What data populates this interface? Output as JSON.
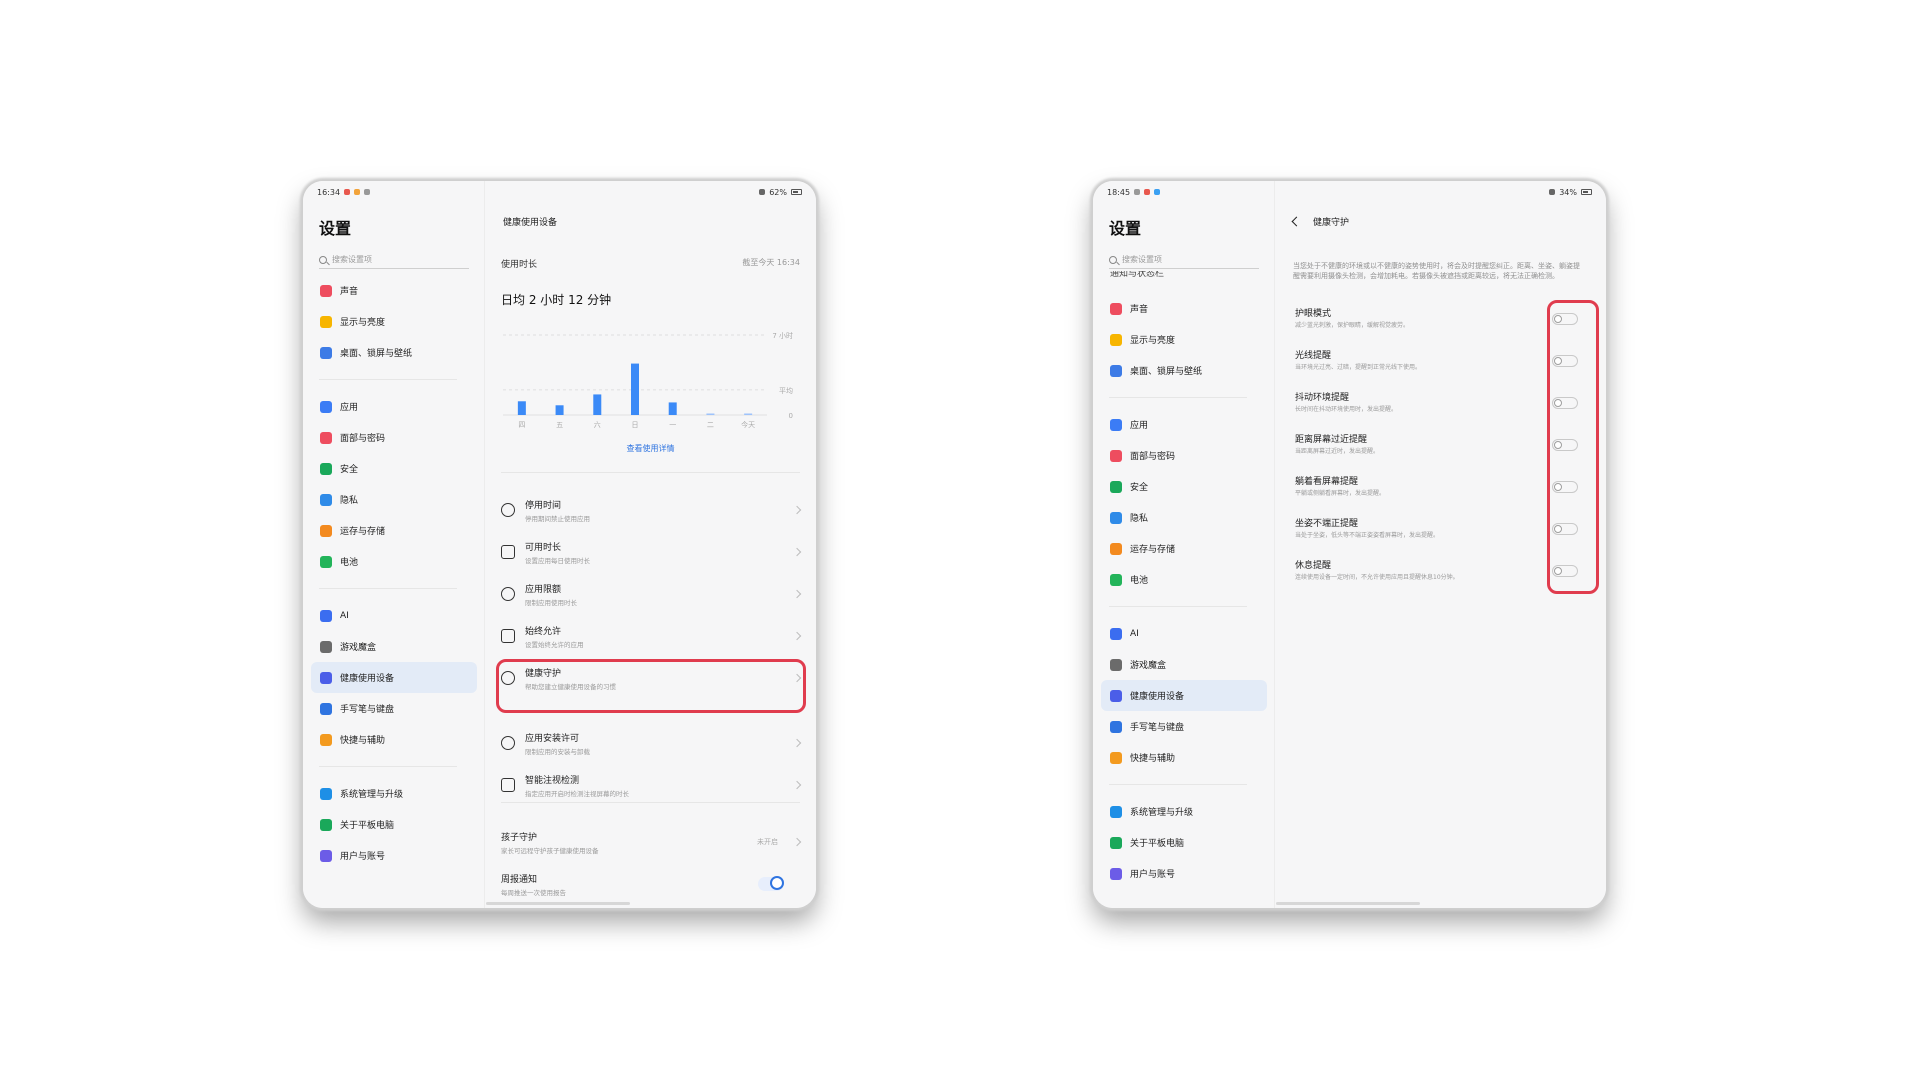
{
  "left": {
    "status": {
      "time": "16:34",
      "battery": "62%"
    },
    "sidebar": {
      "title": "设置",
      "search_placeholder": "搜索设置项",
      "groups": [
        [
          {
            "label": "声音",
            "icon": "speaker-icon",
            "color": "#ee4d5f"
          },
          {
            "label": "显示与亮度",
            "icon": "sun-icon",
            "color": "#f7b500"
          },
          {
            "label": "桌面、锁屏与壁纸",
            "icon": "wallpaper-icon",
            "color": "#3d7be6"
          }
        ],
        [
          {
            "label": "应用",
            "icon": "apps-icon",
            "color": "#3b7cf5"
          },
          {
            "label": "面部与密码",
            "icon": "face-icon",
            "color": "#ee4d5f"
          },
          {
            "label": "安全",
            "icon": "shield-icon",
            "color": "#1aa85a"
          },
          {
            "label": "隐私",
            "icon": "privacy-icon",
            "color": "#2f8be8"
          },
          {
            "label": "运存与存储",
            "icon": "storage-icon",
            "color": "#f38a1f"
          },
          {
            "label": "电池",
            "icon": "battery-icon",
            "color": "#23b45a"
          }
        ],
        [
          {
            "label": "AI",
            "icon": "ai-icon",
            "color": "#3b6df0"
          },
          {
            "label": "游戏魔盒",
            "icon": "gamepad-icon",
            "color": "#6b6b6b"
          },
          {
            "label": "健康使用设备",
            "icon": "hourglass-icon",
            "color": "#4b5ee8",
            "active": true
          },
          {
            "label": "手写笔与键盘",
            "icon": "pen-icon",
            "color": "#2f74e0"
          },
          {
            "label": "快捷与辅助",
            "icon": "shortcut-icon",
            "color": "#f39a1f"
          }
        ],
        [
          {
            "label": "系统管理与升级",
            "icon": "system-icon",
            "color": "#1e8fe6"
          },
          {
            "label": "关于平板电脑",
            "icon": "info-icon",
            "color": "#1aa85a"
          },
          {
            "label": "用户与账号",
            "icon": "user-icon",
            "color": "#6c5ce7"
          }
        ]
      ]
    },
    "content": {
      "title": "健康使用设备",
      "usage_label": "使用时长",
      "usage_time": "截至今天 16:34",
      "usage_avg": "日均 2 小时 12 分钟",
      "chart_link": "查看使用详情",
      "rows_a": [
        {
          "title": "停用时间",
          "sub": "停用期间禁止使用应用",
          "icon": "downtime-icon"
        },
        {
          "title": "可用时长",
          "sub": "设置应用每日使用时长",
          "icon": "timer-icon"
        },
        {
          "title": "应用限额",
          "sub": "限制应用使用时长",
          "icon": "app-limit-icon"
        },
        {
          "title": "始终允许",
          "sub": "设置始终允许的应用",
          "icon": "always-allow-icon"
        },
        {
          "title": "健康守护",
          "sub": "帮助您建立健康使用设备的习惯",
          "icon": "sprout-icon"
        }
      ],
      "rows_b": [
        {
          "title": "应用安装许可",
          "sub": "限制应用的安装与卸载",
          "icon": "install-icon"
        },
        {
          "title": "智能注视检测",
          "sub": "指定应用开启时检测注视屏幕的时长",
          "icon": "gaze-icon"
        }
      ],
      "child": {
        "title": "孩子守护",
        "sub": "家长可远程守护孩子健康使用设备",
        "status": "未开启"
      },
      "weekly": {
        "title": "周报通知",
        "sub": "每周推送一次使用报告"
      }
    },
    "chart_data": {
      "type": "bar",
      "categories": [
        "四",
        "五",
        "六",
        "日",
        "一",
        "二",
        "今天"
      ],
      "values": [
        1.2,
        0.85,
        1.8,
        4.5,
        1.1,
        0,
        0.05
      ],
      "y_tick_labels": [
        "7 小时",
        "平均",
        "0"
      ],
      "ylim": [
        0,
        7
      ],
      "average": 2.2,
      "bar_color": "#3b8af7",
      "grid": true
    }
  },
  "right": {
    "status": {
      "time": "18:45",
      "battery": "34%"
    },
    "sidebar": {
      "title": "设置",
      "search_placeholder": "搜索设置项",
      "clipped_item": "通知与状态栏",
      "groups": [
        [
          {
            "label": "声音",
            "icon": "speaker-icon",
            "color": "#ee4d5f"
          },
          {
            "label": "显示与亮度",
            "icon": "sun-icon",
            "color": "#f7b500"
          },
          {
            "label": "桌面、锁屏与壁纸",
            "icon": "wallpaper-icon",
            "color": "#3d7be6"
          }
        ],
        [
          {
            "label": "应用",
            "icon": "apps-icon",
            "color": "#3b7cf5"
          },
          {
            "label": "面部与密码",
            "icon": "face-icon",
            "color": "#ee4d5f"
          },
          {
            "label": "安全",
            "icon": "shield-icon",
            "color": "#1aa85a"
          },
          {
            "label": "隐私",
            "icon": "privacy-icon",
            "color": "#2f8be8"
          },
          {
            "label": "运存与存储",
            "icon": "storage-icon",
            "color": "#f38a1f"
          },
          {
            "label": "电池",
            "icon": "battery-icon",
            "color": "#23b45a"
          }
        ],
        [
          {
            "label": "AI",
            "icon": "ai-icon",
            "color": "#3b6df0"
          },
          {
            "label": "游戏魔盒",
            "icon": "gamepad-icon",
            "color": "#6b6b6b"
          },
          {
            "label": "健康使用设备",
            "icon": "hourglass-icon",
            "color": "#4b5ee8",
            "active": true
          },
          {
            "label": "手写笔与键盘",
            "icon": "pen-icon",
            "color": "#2f74e0"
          },
          {
            "label": "快捷与辅助",
            "icon": "shortcut-icon",
            "color": "#f39a1f"
          }
        ],
        [
          {
            "label": "系统管理与升级",
            "icon": "system-icon",
            "color": "#1e8fe6"
          },
          {
            "label": "关于平板电脑",
            "icon": "info-icon",
            "color": "#1aa85a"
          },
          {
            "label": "用户与账号",
            "icon": "user-icon",
            "color": "#6c5ce7"
          }
        ]
      ]
    },
    "content": {
      "title": "健康守护",
      "desc": "当您处于不健康的环境或以不健康的姿势使用时，将会及时提醒您纠正。距离、坐姿、躺姿提醒需要利用摄像头检测，会增加耗电。若摄像头被遮挡或距离较远，将无法正确检测。",
      "settings": [
        {
          "title": "护眼模式",
          "sub": "减少蓝光刺激，保护眼睛，缓解视觉疲劳。",
          "on": false
        },
        {
          "title": "光线提醒",
          "sub": "当环境光过亮、过暗，提醒到正常光线下使用。",
          "on": false
        },
        {
          "title": "抖动环境提醒",
          "sub": "长时间在抖动环境使用时，发出提醒。",
          "on": false
        },
        {
          "title": "距离屏幕过近提醒",
          "sub": "当距离屏幕过近时，发出提醒。",
          "on": false
        },
        {
          "title": "躺着看屏幕提醒",
          "sub": "平躺或侧躺看屏幕时，发出提醒。",
          "on": false
        },
        {
          "title": "坐姿不端正提醒",
          "sub": "当处于坐姿，低头等不端正姿姿看屏幕时，发出提醒。",
          "on": false
        },
        {
          "title": "休息提醒",
          "sub": "连续使用设备一定时间，不允许使用应用且提醒休息10分钟。",
          "on": false
        }
      ]
    }
  },
  "colors": {
    "highlight": "#e03c4e",
    "accent": "#2f74e0"
  }
}
